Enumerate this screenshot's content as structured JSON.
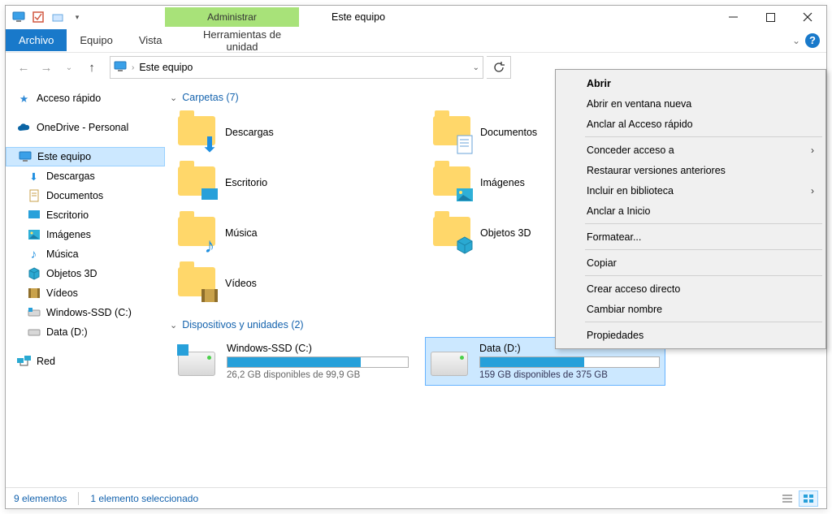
{
  "titlebar": {
    "contextual_tab": "Administrar",
    "title": "Este equipo"
  },
  "menu": {
    "file": "Archivo",
    "tabs": [
      "Equipo",
      "Vista"
    ],
    "contextual": "Herramientas de unidad"
  },
  "address": {
    "crumb": "Este equipo"
  },
  "sidebar": {
    "quick_access": "Acceso rápido",
    "onedrive": "OneDrive - Personal",
    "this_pc": "Este equipo",
    "items": [
      "Descargas",
      "Documentos",
      "Escritorio",
      "Imágenes",
      "Música",
      "Objetos 3D",
      "Vídeos",
      "Windows-SSD (C:)",
      "Data (D:)"
    ],
    "network": "Red"
  },
  "content": {
    "folders_header": "Carpetas (7)",
    "folders": [
      "Descargas",
      "Documentos",
      "Escritorio",
      "Imágenes",
      "Música",
      "Objetos 3D",
      "Vídeos"
    ],
    "drives_header": "Dispositivos y unidades (2)",
    "drives": [
      {
        "name": "Windows-SSD (C:)",
        "free_text": "26,2 GB disponibles de 99,9 GB",
        "used_pct": 74
      },
      {
        "name": "Data (D:)",
        "free_text": "159 GB disponibles de 375 GB",
        "used_pct": 58,
        "selected": true
      }
    ]
  },
  "statusbar": {
    "count": "9 elementos",
    "selection": "1 elemento seleccionado"
  },
  "context_menu": {
    "open": "Abrir",
    "open_new": "Abrir en ventana nueva",
    "pin_quick": "Anclar al Acceso rápido",
    "grant_access": "Conceder acceso a",
    "restore": "Restaurar versiones anteriores",
    "include_lib": "Incluir en biblioteca",
    "pin_start": "Anclar a Inicio",
    "format": "Formatear...",
    "copy": "Copiar",
    "shortcut": "Crear acceso directo",
    "rename": "Cambiar nombre",
    "properties": "Propiedades"
  }
}
